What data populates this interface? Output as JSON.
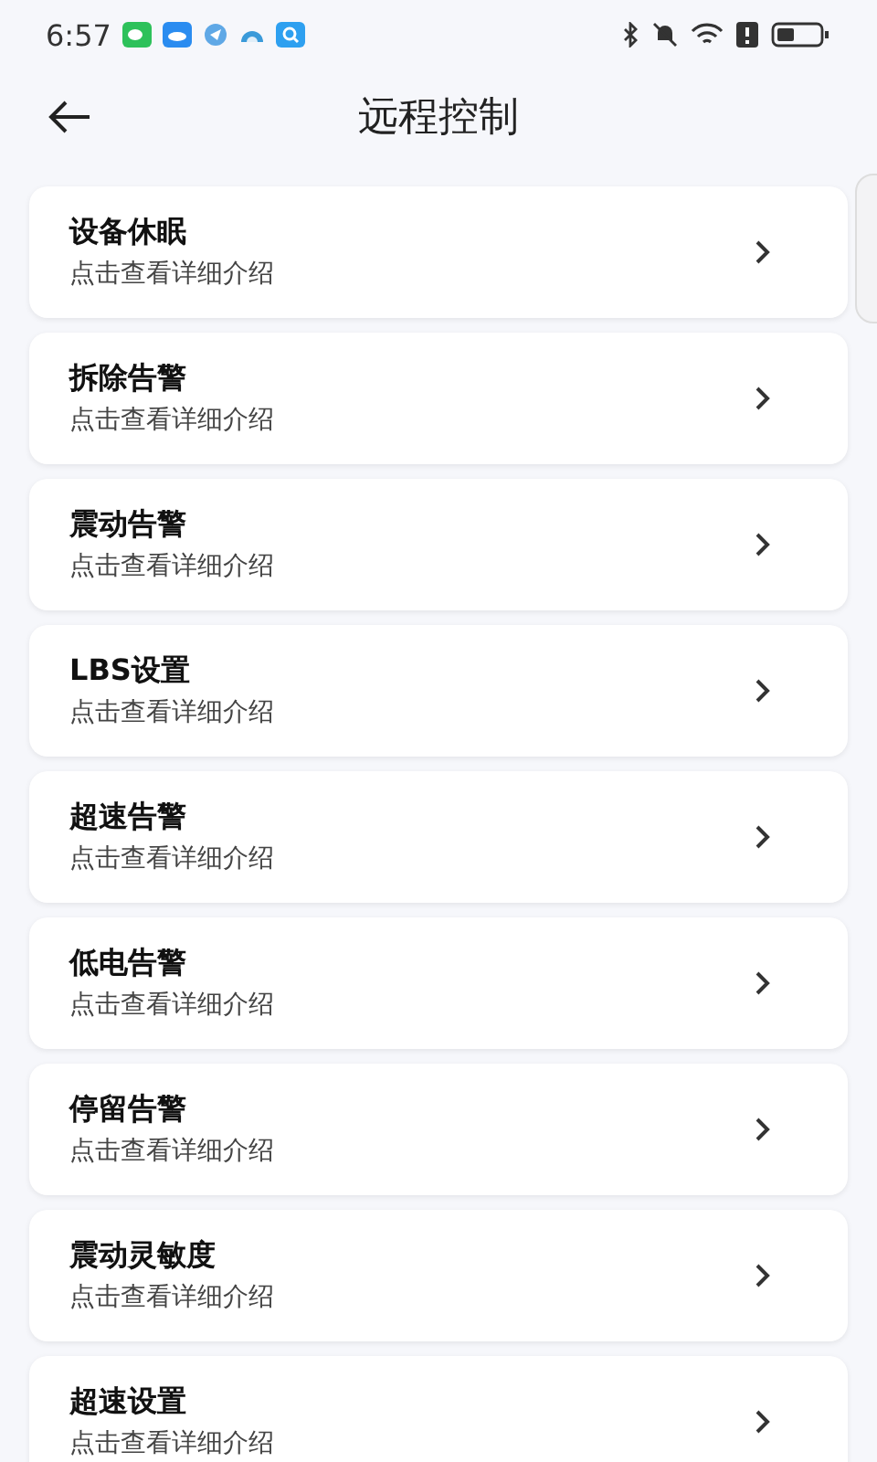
{
  "status_bar": {
    "time": "6:57"
  },
  "header": {
    "title": "远程控制"
  },
  "items": [
    {
      "title": "设备休眠",
      "subtitle": "点击查看详细介绍"
    },
    {
      "title": "拆除告警",
      "subtitle": "点击查看详细介绍"
    },
    {
      "title": "震动告警",
      "subtitle": "点击查看详细介绍"
    },
    {
      "title": "LBS设置",
      "subtitle": "点击查看详细介绍"
    },
    {
      "title": "超速告警",
      "subtitle": "点击查看详细介绍"
    },
    {
      "title": "低电告警",
      "subtitle": "点击查看详细介绍"
    },
    {
      "title": "停留告警",
      "subtitle": "点击查看详细介绍"
    },
    {
      "title": "震动灵敏度",
      "subtitle": "点击查看详细介绍"
    },
    {
      "title": "超速设置",
      "subtitle": "点击查看详细介绍"
    }
  ]
}
